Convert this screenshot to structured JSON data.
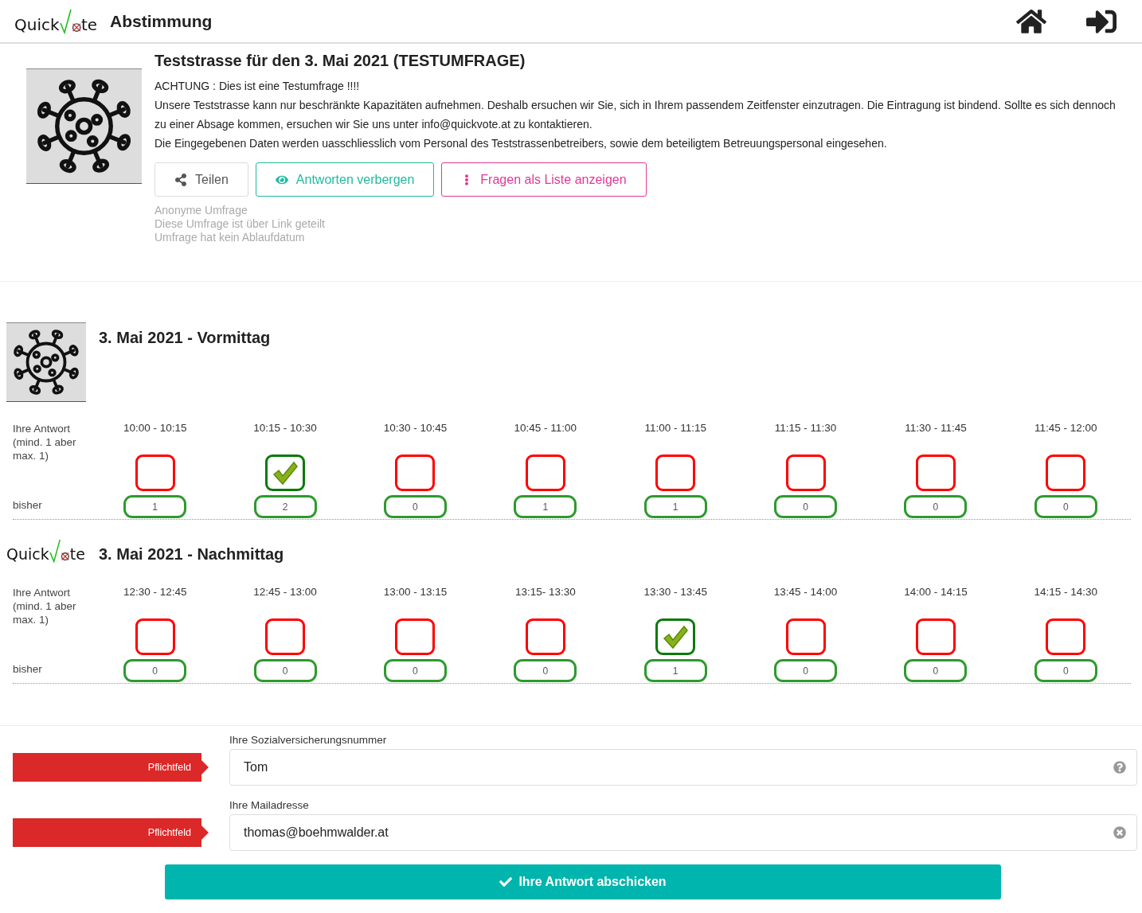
{
  "header": {
    "logo": {
      "before": "Quick",
      "after": "te"
    },
    "title": "Abstimmung"
  },
  "survey": {
    "title": "Teststrasse für den 3. Mai 2021 (TESTUMFRAGE)",
    "paragraphs": [
      "ACHTUNG : Dies ist eine Testumfrage !!!!",
      "Unsere Teststrasse kann nur beschränkte Kapazitäten aufnehmen. Deshalb ersuchen wir Sie, sich in Ihrem passendem Zeitfenster einzutragen. Die Eintragung ist bindend. Sollte es sich dennoch zu einer Absage kommen, ersuchen wir Sie uns unter info@quickvote.at zu kontaktieren.",
      "Die Eingegebenen Daten werden uasschliesslich vom Personal des Teststrassenbetreibers, sowie dem beteiligtem Betreuungspersonal eingesehen."
    ],
    "buttons": [
      {
        "kind": "share",
        "label": "Teilen"
      },
      {
        "kind": "eye",
        "label": "Antworten verbergen"
      },
      {
        "kind": "list",
        "label": "Fragen als Liste anzeigen"
      }
    ],
    "meta": [
      "Anonyme Umfrage",
      "Diese Umfrage ist über Link geteilt",
      "Umfrage hat kein Ablaufdatum"
    ]
  },
  "sections": [
    {
      "image": {
        "kind": "virus"
      },
      "title": "3. Mai 2021 - Vormittag",
      "answer_label": "Ihre Antwort (mind. 1 aber max. 1)",
      "count_label": "bisher",
      "slots": [
        {
          "time": "10:00 - 10:15",
          "checked": false,
          "count": "1"
        },
        {
          "time": "10:15 - 10:30",
          "checked": true,
          "count": "2"
        },
        {
          "time": "10:30 - 10:45",
          "checked": false,
          "count": "0"
        },
        {
          "time": "10:45 - 11:00",
          "checked": false,
          "count": "1"
        },
        {
          "time": "11:00 - 11:15",
          "checked": false,
          "count": "1"
        },
        {
          "time": "11:15 - 11:30",
          "checked": false,
          "count": "0"
        },
        {
          "time": "11:30 - 11:45",
          "checked": false,
          "count": "0"
        },
        {
          "time": "11:45 - 12:00",
          "checked": false,
          "count": "0"
        }
      ]
    },
    {
      "image": {
        "kind": "logo",
        "before": "Quick",
        "after": "te"
      },
      "title": "3. Mai 2021 - Nachmittag",
      "answer_label": "Ihre Antwort (mind. 1 aber max. 1)",
      "count_label": "bisher",
      "slots": [
        {
          "time": "12:30 - 12:45",
          "checked": false,
          "count": "0"
        },
        {
          "time": "12:45 - 13:00",
          "checked": false,
          "count": "0"
        },
        {
          "time": "13:00 - 13:15",
          "checked": false,
          "count": "0"
        },
        {
          "time": "13:15- 13:30",
          "checked": false,
          "count": "0"
        },
        {
          "time": "13:30 - 13:45",
          "checked": true,
          "count": "1"
        },
        {
          "time": "13:45 - 14:00",
          "checked": false,
          "count": "0"
        },
        {
          "time": "14:00 - 14:15",
          "checked": false,
          "count": "0"
        },
        {
          "time": "14:15 - 14:30",
          "checked": false,
          "count": "0"
        }
      ]
    }
  ],
  "fields": [
    {
      "tag": "Pflichtfeld",
      "label": "Ihre Sozialversicherungsnummer",
      "value": "Tom",
      "kind": "help"
    },
    {
      "tag": "Pflichtfeld",
      "label": "Ihre Mailadresse",
      "value": "thomas@boehmwalder.at",
      "kind": "clear"
    }
  ],
  "submit": {
    "label": "Ihre Antwort abschicken"
  }
}
